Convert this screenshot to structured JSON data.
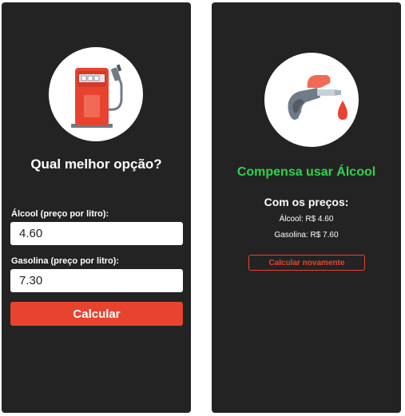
{
  "calculator": {
    "title": "Qual melhor opção?",
    "alcohol_label": "Álcool (preço por litro):",
    "alcohol_value": "4.60",
    "gasoline_label": "Gasolina (preço por litro):",
    "gasoline_value": "7.30",
    "calculate_button": "Calcular",
    "icon": "gas-pump-icon"
  },
  "result": {
    "title": "Compensa usar Álcool",
    "subtitle": "Com os preços:",
    "alcohol_price": "Álcool: R$ 4.60",
    "gasoline_price": "Gasolina: R$ 7.60",
    "recalculate_button": "Calcular novamente",
    "icon": "fuel-nozzle-icon"
  },
  "colors": {
    "panel_bg": "#232323",
    "accent_red": "#e8432f",
    "result_green": "#2fd34d"
  }
}
